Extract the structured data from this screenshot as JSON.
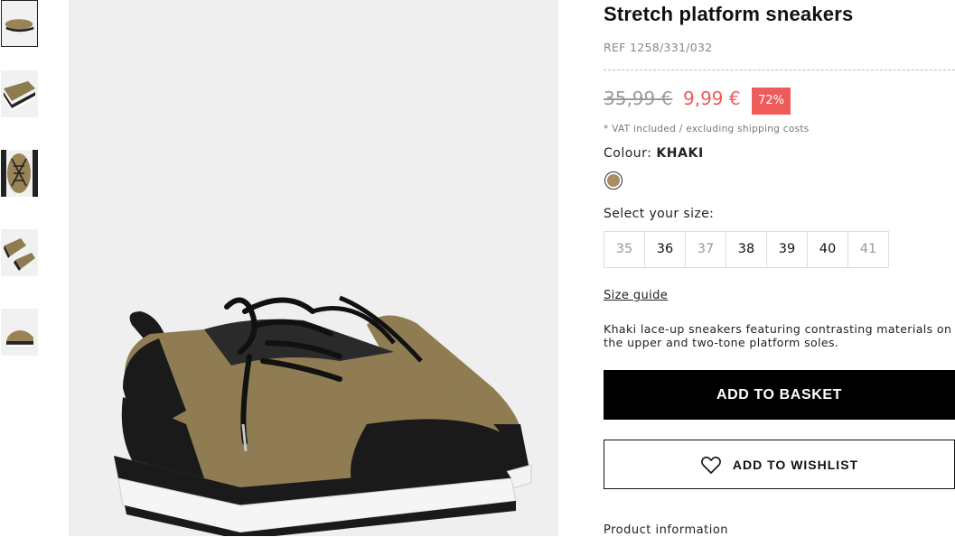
{
  "gallery": {
    "thumbnails": [
      {
        "name": "thumb-side-view",
        "active": true
      },
      {
        "name": "thumb-angle-view",
        "active": false
      },
      {
        "name": "thumb-top-view",
        "active": false
      },
      {
        "name": "thumb-pair-view",
        "active": false
      },
      {
        "name": "thumb-profile-view",
        "active": false
      }
    ],
    "main_image": "khaki-sneaker-photo"
  },
  "product": {
    "title": "Stretch platform sneakers",
    "ref": "REF 1258/331/032",
    "old_price": "35,99 €",
    "new_price": "9,99 €",
    "discount": "72%",
    "vat_note": "* VAT included / excluding shipping costs",
    "colour_label": "Colour:",
    "colour_value": "KHAKI",
    "size_label": "Select your size:",
    "sizes": [
      {
        "label": "35",
        "available": false
      },
      {
        "label": "36",
        "available": true
      },
      {
        "label": "37",
        "available": false
      },
      {
        "label": "38",
        "available": true
      },
      {
        "label": "39",
        "available": true
      },
      {
        "label": "40",
        "available": true
      },
      {
        "label": "41",
        "available": false
      }
    ],
    "size_guide": "Size guide",
    "description": "Khaki lace-up sneakers featuring contrasting materials on the upper and two-tone platform soles.",
    "add_to_basket": "ADD TO BASKET",
    "add_to_wishlist": "ADD TO WISHLIST",
    "product_information": "Product information"
  },
  "colors": {
    "sale": "#f05a5a",
    "swatch_khaki": "#a98e63",
    "button_black": "#000000"
  }
}
